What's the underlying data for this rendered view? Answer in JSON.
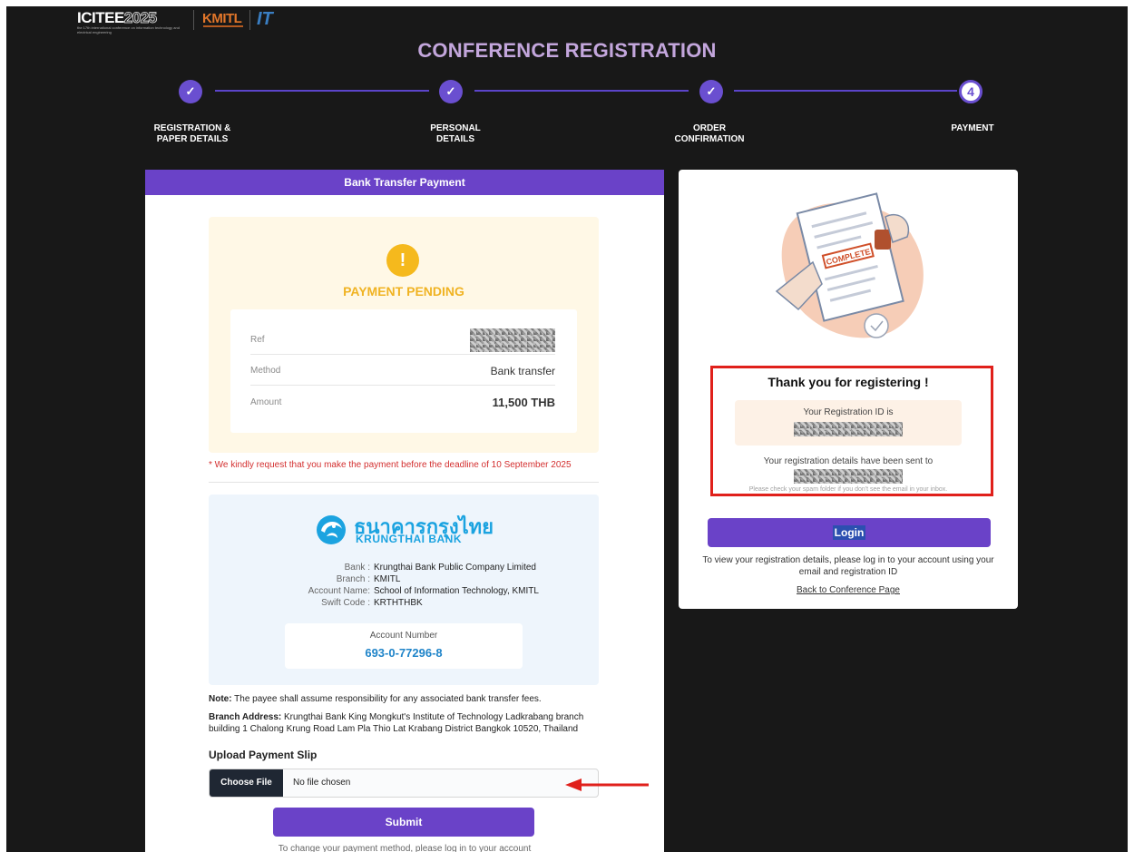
{
  "header": {
    "logo_icitee_main": "ICITEE",
    "logo_icitee_year": "2025",
    "logo_icitee_sub": "the 17th international conference on information technology and electrical engineering",
    "logo_kmitl": "KMITL",
    "logo_it": "IT",
    "page_title": "CONFERENCE REGISTRATION"
  },
  "stepper": {
    "steps": [
      {
        "label_line1": "REGISTRATION &",
        "label_line2": "PAPER DETAILS",
        "state": "done",
        "marker": "✓"
      },
      {
        "label_line1": "PERSONAL",
        "label_line2": "DETAILS",
        "state": "done",
        "marker": "✓"
      },
      {
        "label_line1": "ORDER",
        "label_line2": "CONFIRMATION",
        "state": "done",
        "marker": "✓"
      },
      {
        "label_line1": "PAYMENT",
        "label_line2": "",
        "state": "current",
        "marker": "4"
      }
    ]
  },
  "payment": {
    "header": "Bank Transfer Payment",
    "status": "PAYMENT PENDING",
    "status_icon": "!",
    "rows": {
      "ref_label": "Ref",
      "method_label": "Method",
      "method_value": "Bank transfer",
      "amount_label": "Amount",
      "amount_value": "11,500 THB"
    },
    "deadline_note": "* We kindly request that you make the payment before the deadline of 10 September 2025"
  },
  "bank": {
    "logo_thai": "ธนาคารกรุงไทย",
    "logo_english": "KRUNGTHAI BANK",
    "bank_label": "Bank :",
    "bank_value": "Krungthai Bank Public Company Limited",
    "branch_label": "Branch :",
    "branch_value": "KMITL",
    "account_name_label": "Account Name:",
    "account_name_value": "School of Information Technology, KMITL",
    "swift_label": "Swift Code :",
    "swift_value": "KRTHTHBK",
    "account_number_label": "Account Number",
    "account_number_value": "693-0-77296-8"
  },
  "notes": {
    "note_label": "Note:",
    "note_text": " The payee shall assume responsibility for any associated bank transfer fees.",
    "branch_address_label": "Branch Address:",
    "branch_address_text": " Krungthai Bank King Mongkut's Institute of Technology Ladkrabang branch building 1 Chalong Krung Road Lam Pla Thio Lat Krabang District Bangkok 10520, Thailand"
  },
  "upload": {
    "title": "Upload Payment Slip",
    "choose_file": "Choose File",
    "no_file": "No file chosen",
    "submit": "Submit",
    "change_method": "To change your payment method, please log in to your account"
  },
  "confirmation": {
    "thank_you": "Thank you for registering !",
    "reg_id_label": "Your Registration ID is",
    "sent_label": "Your registration details have been sent to",
    "spam_note": "Please check your spam folder if you don't see the email in your inbox.",
    "login": "Login",
    "view_info": "To view your registration details, please log in to your account using your email and registration ID",
    "back_link": "Back to Conference Page"
  },
  "colors": {
    "primary": "#6a42c8",
    "title": "#c3a6dc",
    "pending": "#f0b323",
    "deadline": "#d32f2f",
    "account_number": "#1f84c9",
    "annotation": "#e0201b"
  }
}
